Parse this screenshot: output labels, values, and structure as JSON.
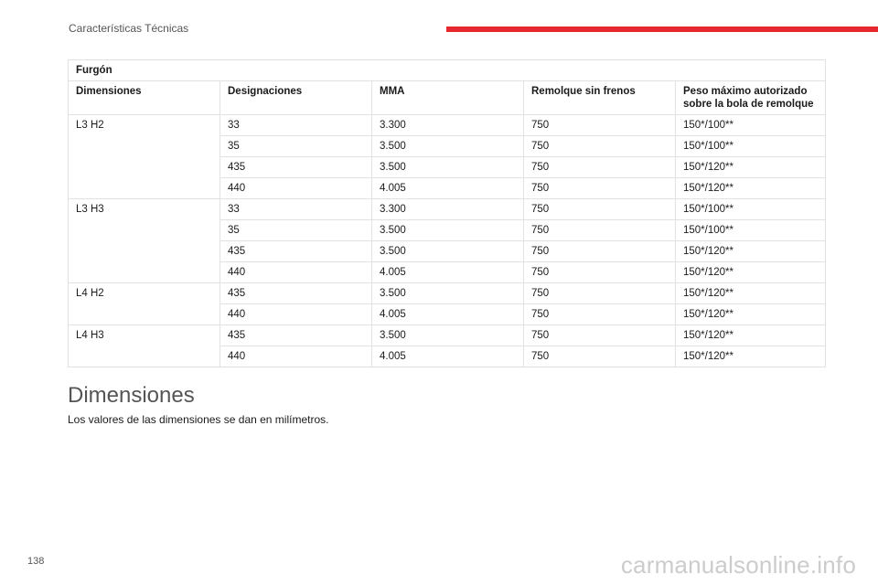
{
  "header": {
    "section": "Características Técnicas",
    "accent_color": "#e8262e"
  },
  "table": {
    "caption": "Furgón",
    "columns": [
      "Dimensiones",
      "Designaciones",
      "MMA",
      "Remolque sin frenos",
      "Peso máximo autorizado sobre la bola de remolque"
    ],
    "groups": [
      {
        "dimension": "L3 H2",
        "rows": [
          [
            "33",
            "3.300",
            "750",
            "150*/100**"
          ],
          [
            "35",
            "3.500",
            "750",
            "150*/100**"
          ],
          [
            "435",
            "3.500",
            "750",
            "150*/120**"
          ],
          [
            "440",
            "4.005",
            "750",
            "150*/120**"
          ]
        ]
      },
      {
        "dimension": "L3 H3",
        "rows": [
          [
            "33",
            "3.300",
            "750",
            "150*/100**"
          ],
          [
            "35",
            "3.500",
            "750",
            "150*/100**"
          ],
          [
            "435",
            "3.500",
            "750",
            "150*/120**"
          ],
          [
            "440",
            "4.005",
            "750",
            "150*/120**"
          ]
        ]
      },
      {
        "dimension": "L4 H2",
        "rows": [
          [
            "435",
            "3.500",
            "750",
            "150*/120**"
          ],
          [
            "440",
            "4.005",
            "750",
            "150*/120**"
          ]
        ]
      },
      {
        "dimension": "L4 H3",
        "rows": [
          [
            "435",
            "3.500",
            "750",
            "150*/120**"
          ],
          [
            "440",
            "4.005",
            "750",
            "150*/120**"
          ]
        ]
      }
    ]
  },
  "section": {
    "title": "Dimensiones",
    "text": "Los valores de las dimensiones se dan en milímetros."
  },
  "footer": {
    "page_number": "138",
    "watermark": "carmanualsonline.info"
  }
}
